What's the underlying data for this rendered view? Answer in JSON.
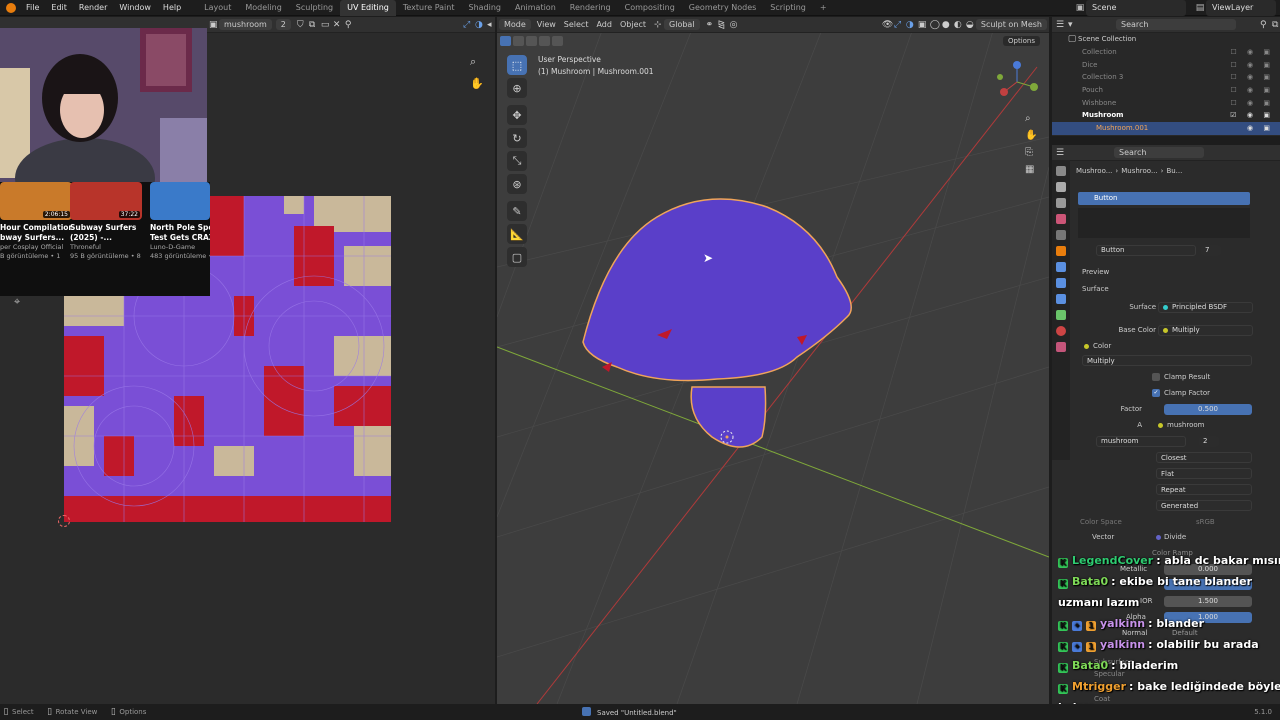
{
  "topmenu": {
    "items": [
      "File",
      "Edit",
      "Render",
      "Window",
      "Help"
    ]
  },
  "workspaces": [
    "Layout",
    "Modeling",
    "Sculpting",
    "UV Editing",
    "Texture Paint",
    "Shading",
    "Animation",
    "Rendering",
    "Compositing",
    "Geometry Nodes",
    "Scripting"
  ],
  "active_workspace": "UV Editing",
  "scene": {
    "label": "Scene",
    "viewlayer": "ViewLayer"
  },
  "uv_header": {
    "view": "View",
    "image": "Image",
    "image_name": "mushroom",
    "users": "2"
  },
  "vp_header": {
    "mode": "Mode",
    "view": "View",
    "select": "Select",
    "add": "Add",
    "object": "Object",
    "orientation": "Global",
    "sculpt": "Sculpt on Mesh",
    "options": "Options"
  },
  "viewport": {
    "perspective": "User Perspective",
    "object_info": "(1) Mushroom | Mushroom.001"
  },
  "outliner": {
    "search_placeholder": "Search",
    "root": "Scene Collection",
    "items": [
      "Collection",
      "Dice",
      "Collection 3",
      "Pouch",
      "Wishbone"
    ],
    "active": "Mushroom",
    "child": "Mushroom.001"
  },
  "properties": {
    "search_placeholder": "Search",
    "crumb1": "Mushroo...",
    "crumb2": "Mushroo...",
    "crumb3": "Bu...",
    "slot": "Button",
    "material_name": "Button",
    "material_users": "7",
    "preview": "Preview",
    "surface": "Surface",
    "surface_label": "Surface",
    "surface_value": "Principled BSDF",
    "base_color_label": "Base Color",
    "base_color_value": "Multiply",
    "color_label": "Color",
    "blend_mode": "Multiply",
    "clamp_result": "Clamp Result",
    "clamp_factor": "Clamp Factor",
    "factor_label": "Factor",
    "factor_value": "0.500",
    "a_label": "A",
    "a_value": "mushroom",
    "image_name": "mushroom",
    "image_users": "2",
    "interp": "Closest",
    "proj": "Flat",
    "ext": "Repeat",
    "source": "Generated",
    "color_space_label": "Color Space",
    "color_space_value": "sRGB",
    "vector_label": "Vector",
    "vector_value": "Divide",
    "color_ramp": "Color Ramp",
    "metallic_label": "Metallic",
    "metallic_value": "0.000",
    "ior_label": "IOR",
    "ior_value": "1.500",
    "alpha_label": "Alpha",
    "alpha_value": "1.000",
    "normal_label": "Normal",
    "normal_value": "Default",
    "subsurface": "Subsurface",
    "specular": "Specular",
    "coat": "Coat"
  },
  "chat": [
    {
      "user": "LegendCover",
      "color": "#2ecc71",
      "text": ": abla dc bakar mısın",
      "badges": 1
    },
    {
      "user": "Bata0",
      "color": "#7ed957",
      "text": ": ekibe bi tane blander",
      "badges": 1
    },
    {
      "user": "",
      "color": "#fff",
      "text": "uzmanı lazım",
      "badges": 0
    },
    {
      "user": "yalkinn",
      "color": "#c792ea",
      "text": ": blander",
      "badges": 3
    },
    {
      "user": "yalkinn",
      "color": "#c792ea",
      "text": ": olabilir bu arada",
      "badges": 3
    },
    {
      "user": "Bata0",
      "color": "#7ed957",
      "text": ": biladerim",
      "badges": 1
    },
    {
      "user": "Mtrigger",
      "color": "#f0a030",
      "text": ": bake lediğindede böylemi",
      "badges": 1
    },
    {
      "user": "",
      "color": "#fff",
      "text": "kalıyo",
      "badges": 0
    }
  ],
  "youtube": [
    {
      "title": "Hour Compilation",
      "title2": "bway Surfers...",
      "channel": "per Cosplay Official",
      "views": "B görüntüleme • 1",
      "duration": "2:06:15"
    },
    {
      "title": "Subway Surfers",
      "title2": "(2025) -...",
      "channel": "Throneful",
      "views": "95 B görüntüleme • 8",
      "duration": "37:22"
    },
    {
      "title": "North Pole Spee",
      "title2": "Test Gets CRAZY",
      "channel": "Luno-D-Game",
      "views": "483 görüntüleme • 8",
      "duration": ""
    }
  ],
  "status": {
    "select": "Select",
    "rotate": "Rotate View",
    "options": "Options",
    "saved": "Saved \"Untitled.blend\"",
    "version": "5.1.0"
  },
  "colors": {
    "accent": "#4772b3",
    "mushroom": "#5a3fc9",
    "outline": "#f0a45a",
    "uv_purple": "#7a4fd6",
    "uv_red": "#c0182a",
    "uv_beige": "#c9b89a"
  }
}
